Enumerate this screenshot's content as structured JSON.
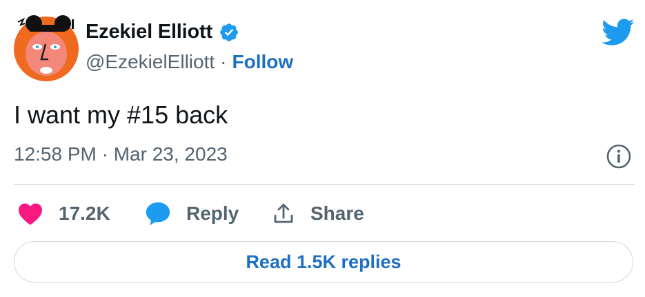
{
  "author": {
    "display_name": "Ezekiel Elliott",
    "handle": "@EzekielElliott",
    "separator": "·",
    "follow_label": "Follow",
    "verified_icon": "verified-badge-icon",
    "avatar_icon": "cartoon-face-avatar"
  },
  "tweet": {
    "text": "I want my #15 back",
    "timestamp": "12:58 PM · Mar 23, 2023"
  },
  "actions": {
    "likes_count": "17.2K",
    "reply_label": "Reply",
    "share_label": "Share"
  },
  "read_replies_label": "Read 1.5K replies",
  "colors": {
    "brand_blue": "#1d9bf0",
    "link_blue": "#1d6fc2",
    "heart_pink": "#f91880",
    "muted_text": "#536471",
    "avatar_orange": "#ef6a1f"
  }
}
